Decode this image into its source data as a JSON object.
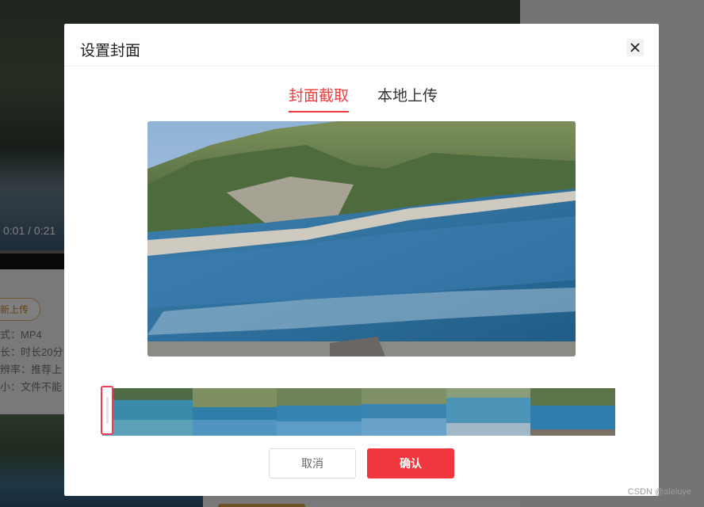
{
  "background": {
    "video_time": "0:01 / 0:21",
    "badge": "新上传",
    "info_lines": [
      "式：MP4",
      "长：时长20分",
      "辨率：推荐上",
      "小：文件不能"
    ]
  },
  "modal": {
    "title": "设置封面",
    "close_icon": "close-icon",
    "tabs": [
      {
        "label": "封面截取",
        "active": true
      },
      {
        "label": "本地上传",
        "active": false
      }
    ],
    "cancel_label": "取消",
    "confirm_label": "确认"
  },
  "filmstrip": {
    "frame_count": 6,
    "selected_index": 0
  },
  "colors": {
    "accent": "#ef3b3b",
    "confirm_bg": "#f0373d",
    "overlay": "rgba(0,0,0,0.5)"
  },
  "watermark": "CSDN @aleluye"
}
